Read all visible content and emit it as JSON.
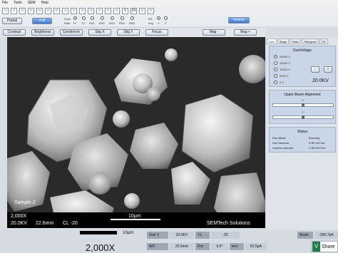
{
  "menu": [
    "File",
    "Tools",
    "SEM",
    "Help"
  ],
  "toolbar_icons": [
    "□",
    "□",
    "□",
    "□",
    "□",
    "□",
    "□",
    "□",
    "□",
    "□",
    "□",
    "□",
    "□",
    "□",
    "V",
    "2X",
    "□",
    "□"
  ],
  "controls": {
    "partial": "Partial",
    "full": "Full",
    "scan_label": "Scan",
    "rate_label": "Rate",
    "rs_label": "RS",
    "avg_label": "Avg",
    "scan_options": [
      "TV",
      "TV",
      "RS1",
      "RS2",
      "RS3",
      "RS4",
      "RS5"
    ],
    "avg_options": [
      "1",
      "2"
    ],
    "freeze": "Freeze",
    "contrast": "Contrast",
    "brightness": "Brightness",
    "condenser": "Condenser",
    "stig_x": "Stig X",
    "stig_y": "Stig Y",
    "focus": "Focus",
    "mag_minus": "Mag -",
    "mag_plus": "Mag +"
  },
  "image": {
    "sample_label": "Sample 2",
    "mag": "2,000X",
    "kv": "20.0KV",
    "wd": "22.6mm",
    "cl": "CL -20",
    "scale": "10μm",
    "company": "SEMTech Solutions"
  },
  "side_tabs": [
    "Gun",
    "Stage",
    "Video",
    "Histogram",
    "FE"
  ],
  "gun_voltage": {
    "title": "GunVoltage",
    "options": [
      "20000 V",
      "15000 V",
      "10000 V",
      "5000 V",
      "0 V"
    ],
    "selected": 0,
    "value": "20.0KV",
    "minus": "-",
    "plus": "+"
  },
  "beam_alignment": {
    "title": "Upper Beam Alignment",
    "x": "X",
    "y": "Y"
  },
  "status": {
    "title": "Status",
    "rows": [
      {
        "k": "Gun Mode",
        "v": "Running"
      },
      {
        "k": "Gun Vacuum",
        "v": "6.3E-011Torr"
      },
      {
        "k": "Column Vacuum",
        "v": "1.3E-007Torr"
      }
    ]
  },
  "bottom": {
    "mag_big": "2,000X",
    "scale": "10μm",
    "gun_v_label": "Gun V",
    "gun_v": "20.0KV",
    "cl_label": "CL",
    "cl": "-20",
    "wd_label": "WD",
    "wd": "22.6mm",
    "rot_label": "Rot",
    "rot": "0.0°",
    "text_label": "text",
    "text_val": "81.5pA",
    "beam_label": "Beam",
    "beam": "-290.7pA",
    "share": "Share"
  }
}
